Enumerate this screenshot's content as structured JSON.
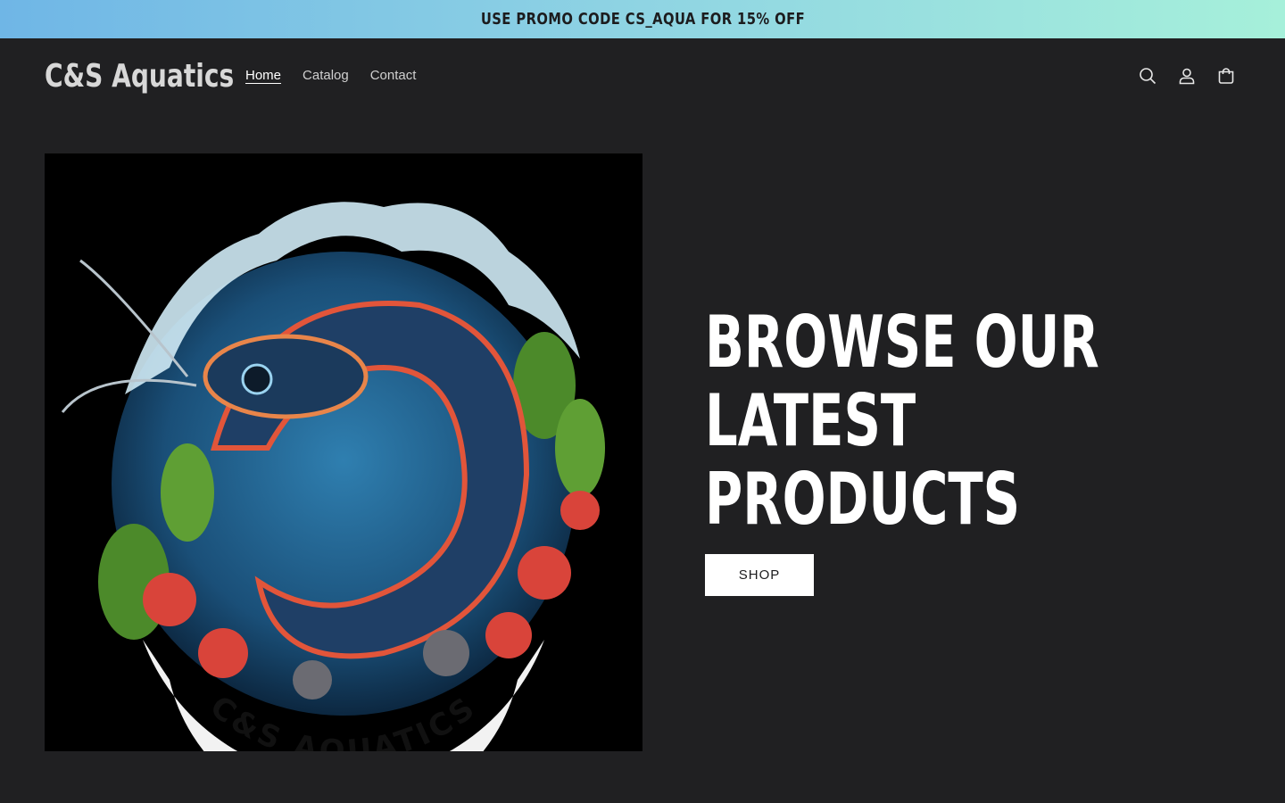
{
  "announcement": {
    "text": "USE PROMO CODE CS_AQUA FOR 15% OFF"
  },
  "header": {
    "logo": "C&S Aquatics",
    "nav": [
      {
        "label": "Home",
        "active": true
      },
      {
        "label": "Catalog",
        "active": false
      },
      {
        "label": "Contact",
        "active": false
      }
    ],
    "icons": [
      "search-icon",
      "account-icon",
      "cart-icon"
    ]
  },
  "hero": {
    "image_logo_text": "C&S AQUATICS",
    "title_lines": [
      "BROWSE OUR",
      "LATEST",
      "PRODUCTS"
    ],
    "button_label": "SHOP"
  },
  "colors": {
    "background": "#202022",
    "accent_gradient_start": "#6fb6e6",
    "accent_gradient_end": "#a6f0da",
    "text": "#ffffff"
  }
}
